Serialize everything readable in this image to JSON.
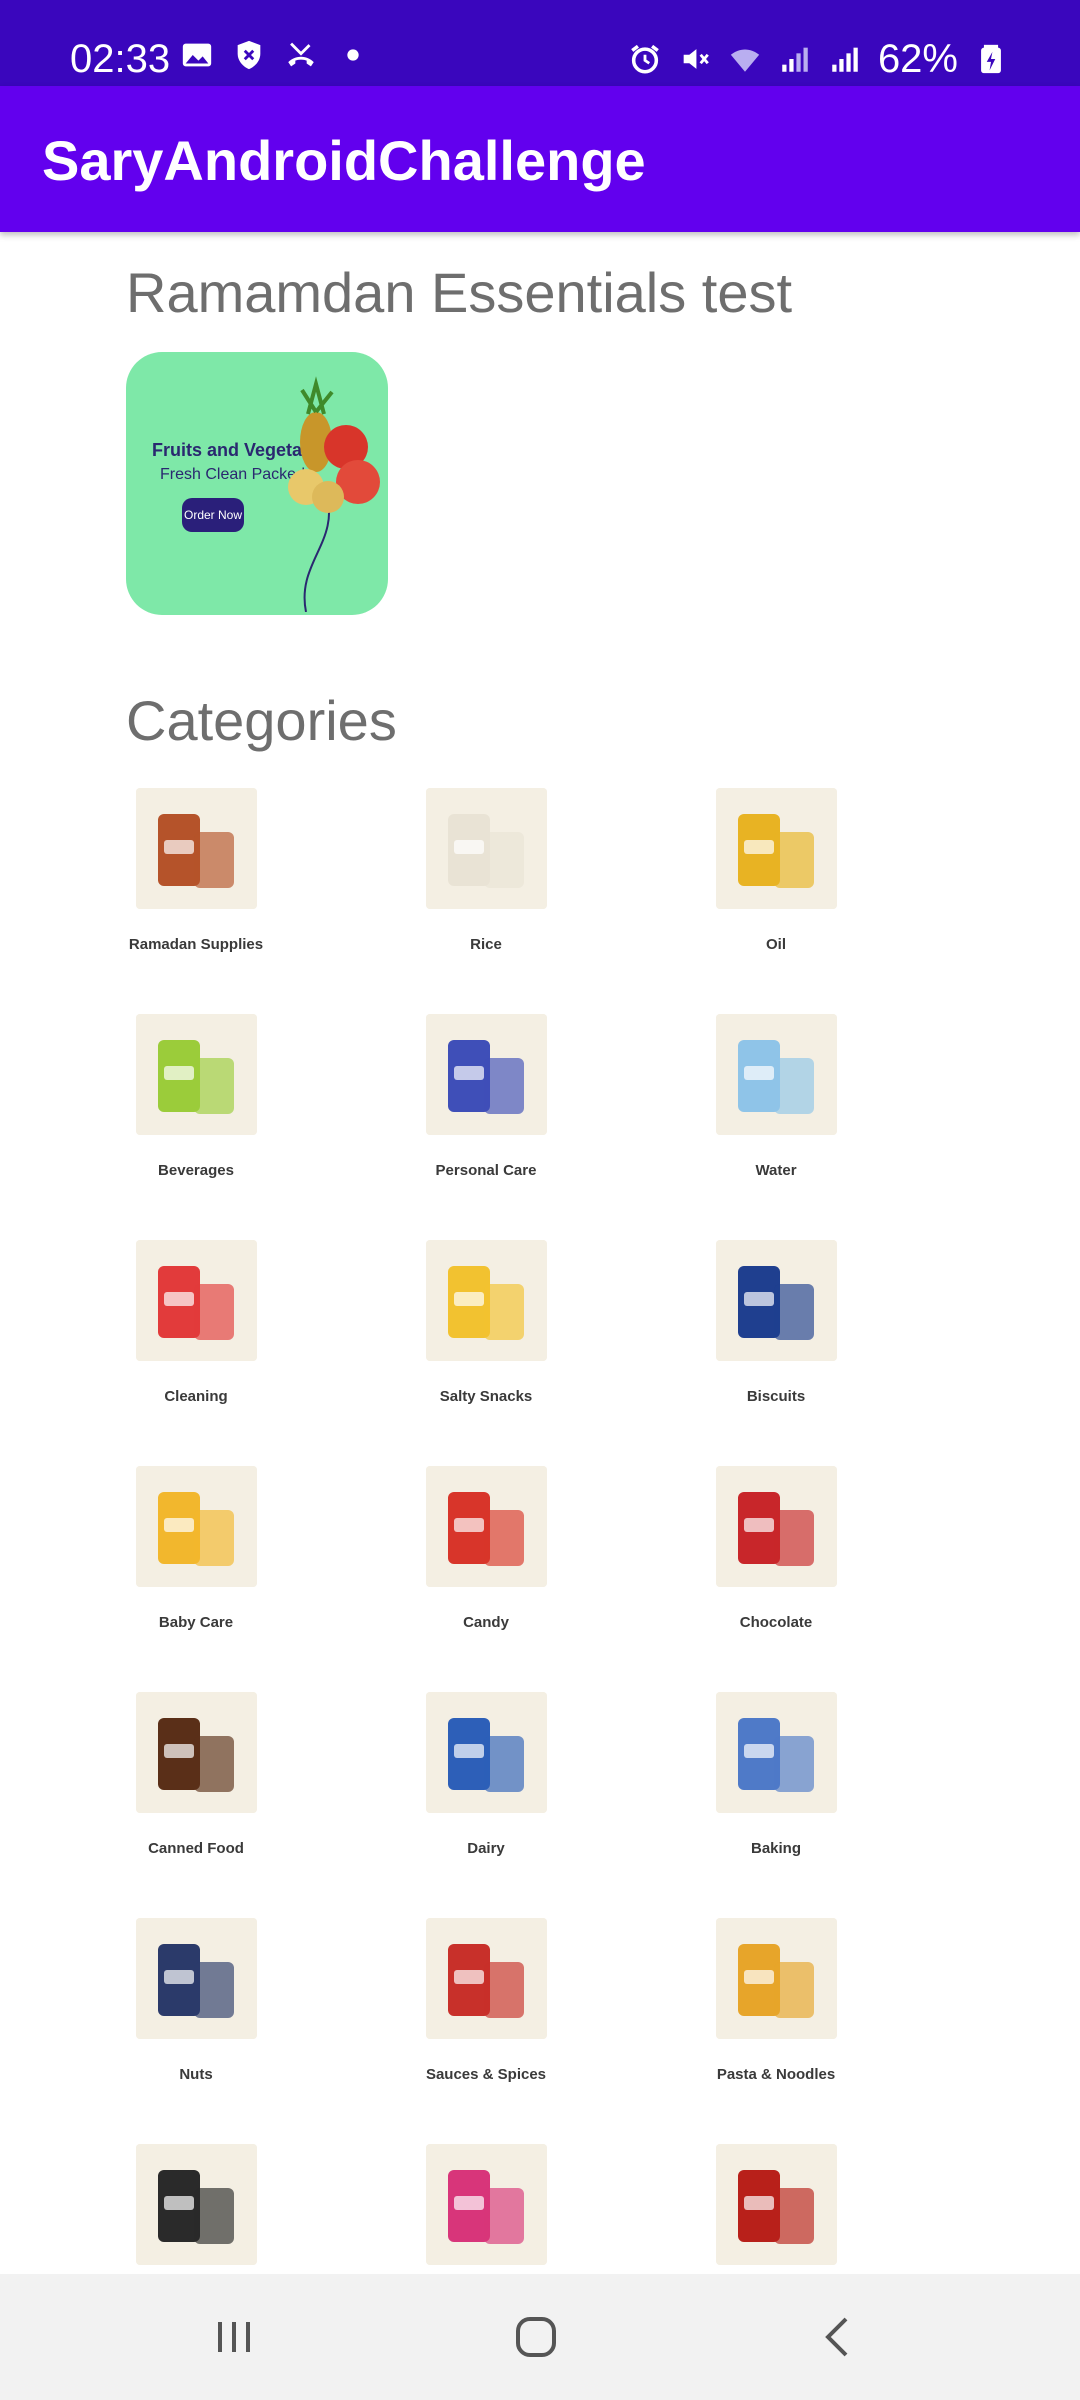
{
  "status_bar": {
    "time": "02:33",
    "battery": "62%",
    "icons_left": [
      "image-icon",
      "shield-icon",
      "missed-call-icon",
      "dot-icon"
    ],
    "icons_right": [
      "alarm-icon",
      "mute-icon",
      "wifi-icon",
      "signal-icon",
      "signal-icon",
      "battery-icon"
    ]
  },
  "app_bar": {
    "title": "SaryAndroidChallenge"
  },
  "banner_section": {
    "title": "Ramamdan Essentials test",
    "banner": {
      "headline": "Fruits and Vegetables",
      "subline": "Fresh Clean Packed",
      "button": "Order Now"
    }
  },
  "categories_section": {
    "title": "Categories",
    "items": [
      {
        "label": "Ramadan Supplies",
        "icon": "dried-fruits-icon",
        "color": "#b5532a"
      },
      {
        "label": "Rice",
        "icon": "rice-bag-icon",
        "color": "#e9e3d5"
      },
      {
        "label": "Oil",
        "icon": "oil-bottle-icon",
        "color": "#e8b323"
      },
      {
        "label": "Beverages",
        "icon": "drink-can-icon",
        "color": "#9bcc3a"
      },
      {
        "label": "Personal Care",
        "icon": "care-pack-icon",
        "color": "#3f4fb8"
      },
      {
        "label": "Water",
        "icon": "water-bottle-icon",
        "color": "#8fc4e8"
      },
      {
        "label": "Cleaning",
        "icon": "detergent-icon",
        "color": "#e23b3b"
      },
      {
        "label": "Salty Snacks",
        "icon": "chips-bag-icon",
        "color": "#f2c230"
      },
      {
        "label": "Biscuits",
        "icon": "biscuit-pack-icon",
        "color": "#1f3f8f"
      },
      {
        "label": "Baby Care",
        "icon": "baby-care-icon",
        "color": "#f2b72d"
      },
      {
        "label": "Candy",
        "icon": "candy-icon",
        "color": "#d8352a"
      },
      {
        "label": "Chocolate",
        "icon": "chocolate-icon",
        "color": "#c8262a"
      },
      {
        "label": "Canned Food",
        "icon": "jar-icon",
        "color": "#5a2f18"
      },
      {
        "label": "Dairy",
        "icon": "dairy-icon",
        "color": "#2d5fb8"
      },
      {
        "label": "Baking",
        "icon": "flour-bag-icon",
        "color": "#4f7ac8"
      },
      {
        "label": "Nuts",
        "icon": "nuts-bag-icon",
        "color": "#2b3a6a"
      },
      {
        "label": "Sauces & Spices",
        "icon": "sauce-jar-icon",
        "color": "#c8302a"
      },
      {
        "label": "Pasta & Noodles",
        "icon": "noodles-icon",
        "color": "#e7a52a"
      },
      {
        "label": "",
        "icon": "oats-tin-icon",
        "color": "#2a2a2a"
      },
      {
        "label": "",
        "icon": "snack-pack-icon",
        "color": "#d8357a"
      },
      {
        "label": "",
        "icon": "coffee-jar-icon",
        "color": "#b8201a"
      }
    ]
  },
  "nav_bar": {
    "buttons": [
      "recents-icon",
      "home-icon",
      "back-icon"
    ]
  }
}
